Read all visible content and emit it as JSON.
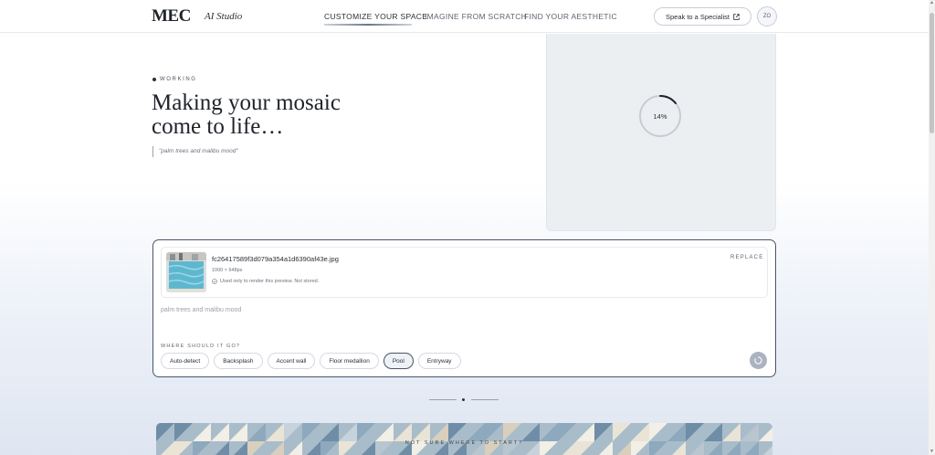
{
  "header": {
    "logo": "MEC",
    "studio": "AI Studio",
    "nav": [
      {
        "label": "CUSTOMIZE YOUR SPACE",
        "active": true
      },
      {
        "label": "IMAGINE FROM SCRATCH",
        "active": false
      },
      {
        "label": "FIND YOUR AESTHETIC",
        "active": false
      }
    ],
    "specialist_label": "Speak to a Specialist",
    "avatar_initials": "ZO"
  },
  "hero": {
    "status": "WORKING",
    "title": "Making your mosaic come to life…",
    "prompt_quote": "\"palm trees and malibu mood\""
  },
  "preview": {
    "progress_label": "14%",
    "progress_value": 14
  },
  "upload": {
    "filename": "fc26417589f3d079a354a1d6390af43e.jpg",
    "dimensions": "1000 × 648px",
    "privacy_note": "Used only to render this preview. Not stored.",
    "replace_label": "REPLACE",
    "prompt_text": "palm trees and malibu mood",
    "where_label": "WHERE SHOULD IT GO?",
    "placements": [
      {
        "label": "Auto-detect",
        "selected": false
      },
      {
        "label": "Backsplash",
        "selected": false
      },
      {
        "label": "Accent wall",
        "selected": false
      },
      {
        "label": "Floor medallion",
        "selected": false
      },
      {
        "label": "Pool",
        "selected": true
      },
      {
        "label": "Entryway",
        "selected": false
      }
    ]
  },
  "banner": {
    "label": "NOT SURE WHERE TO START?"
  },
  "colors": {
    "accent": "#4a5568",
    "preview_bg": "#eceff1",
    "submit_disabled": "#aab3bf"
  }
}
